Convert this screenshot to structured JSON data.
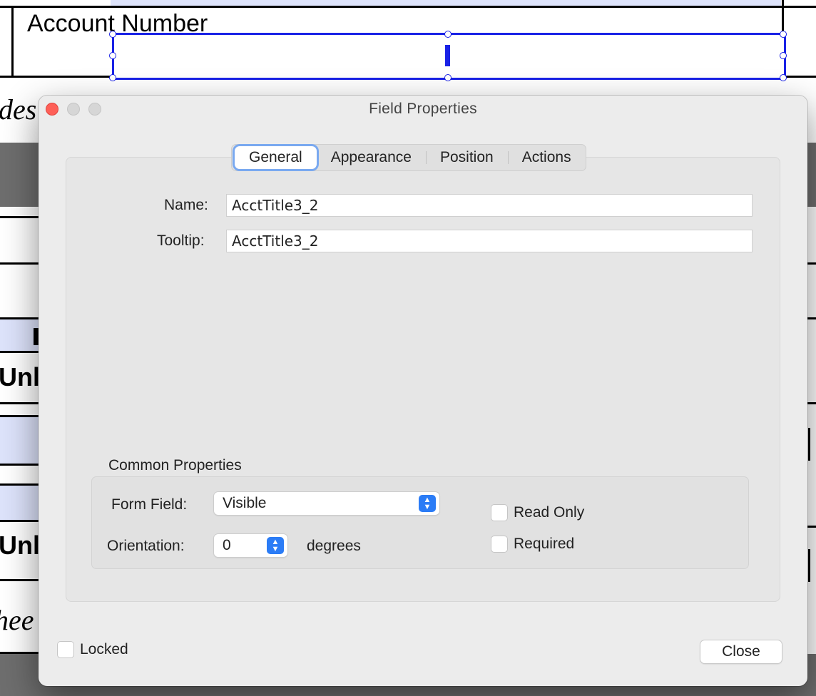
{
  "background_form": {
    "account_number_label": "Account Number",
    "frag_des": "des",
    "frag_unl_1": "Unl",
    "frag_unl_2": "Unl",
    "frag_shee": "hee"
  },
  "dialog": {
    "title": "Field Properties",
    "tabs": [
      {
        "label": "General",
        "active": true
      },
      {
        "label": "Appearance",
        "active": false
      },
      {
        "label": "Position",
        "active": false
      },
      {
        "label": "Actions",
        "active": false
      }
    ],
    "name": {
      "label": "Name:",
      "value": "AcctTitle3_2"
    },
    "tooltip": {
      "label": "Tooltip:",
      "value": "AcctTitle3_2"
    },
    "common_properties": {
      "title": "Common Properties",
      "form_field": {
        "label": "Form Field:",
        "value": "Visible"
      },
      "orientation": {
        "label": "Orientation:",
        "value": "0",
        "unit": "degrees"
      },
      "read_only": {
        "label": "Read Only",
        "checked": false
      },
      "required": {
        "label": "Required",
        "checked": false
      }
    },
    "locked": {
      "label": "Locked",
      "checked": false
    },
    "close_button": "Close"
  },
  "colors": {
    "selection": "#1a22e6",
    "accent": "#2b7cf6",
    "close_light": "#fe5f57",
    "form_highlight": "#dde3fb",
    "form_dark_band": "#6e6e6e"
  }
}
